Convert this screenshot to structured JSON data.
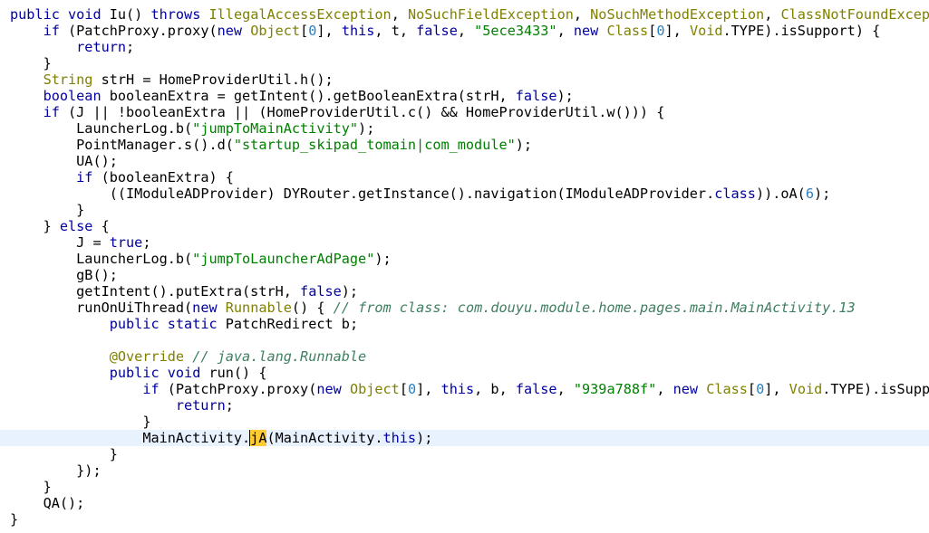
{
  "editor": {
    "lines": [
      {
        "indent": 0,
        "tokens": [
          {
            "t": "kw",
            "v": "public"
          },
          {
            "t": "plain",
            "v": " "
          },
          {
            "t": "kw",
            "v": "void"
          },
          {
            "t": "plain",
            "v": " Iu() "
          },
          {
            "t": "kw",
            "v": "throws"
          },
          {
            "t": "plain",
            "v": " "
          },
          {
            "t": "type",
            "v": "IllegalAccessException"
          },
          {
            "t": "plain",
            "v": ", "
          },
          {
            "t": "type",
            "v": "NoSuchFieldException"
          },
          {
            "t": "plain",
            "v": ", "
          },
          {
            "t": "type",
            "v": "NoSuchMethodException"
          },
          {
            "t": "plain",
            "v": ", "
          },
          {
            "t": "type",
            "v": "ClassNotFoundExcept"
          }
        ]
      },
      {
        "indent": 1,
        "tokens": [
          {
            "t": "kw",
            "v": "if"
          },
          {
            "t": "plain",
            "v": " (PatchProxy.proxy("
          },
          {
            "t": "kw",
            "v": "new"
          },
          {
            "t": "plain",
            "v": " "
          },
          {
            "t": "type",
            "v": "Object"
          },
          {
            "t": "plain",
            "v": "["
          },
          {
            "t": "num",
            "v": "0"
          },
          {
            "t": "plain",
            "v": "], "
          },
          {
            "t": "kw",
            "v": "this"
          },
          {
            "t": "plain",
            "v": ", t, "
          },
          {
            "t": "lit",
            "v": "false"
          },
          {
            "t": "plain",
            "v": ", "
          },
          {
            "t": "str",
            "v": "\"5ece3433\""
          },
          {
            "t": "plain",
            "v": ", "
          },
          {
            "t": "kw",
            "v": "new"
          },
          {
            "t": "plain",
            "v": " "
          },
          {
            "t": "type",
            "v": "Class"
          },
          {
            "t": "plain",
            "v": "["
          },
          {
            "t": "num",
            "v": "0"
          },
          {
            "t": "plain",
            "v": "], "
          },
          {
            "t": "type",
            "v": "Void"
          },
          {
            "t": "plain",
            "v": ".TYPE).isSupport) {"
          }
        ]
      },
      {
        "indent": 2,
        "tokens": [
          {
            "t": "kw",
            "v": "return"
          },
          {
            "t": "plain",
            "v": ";"
          }
        ]
      },
      {
        "indent": 1,
        "tokens": [
          {
            "t": "plain",
            "v": "}"
          }
        ]
      },
      {
        "indent": 1,
        "tokens": [
          {
            "t": "type",
            "v": "String"
          },
          {
            "t": "plain",
            "v": " strH = HomeProviderUtil.h();"
          }
        ]
      },
      {
        "indent": 1,
        "tokens": [
          {
            "t": "kw",
            "v": "boolean"
          },
          {
            "t": "plain",
            "v": " booleanExtra = getIntent().getBooleanExtra(strH, "
          },
          {
            "t": "lit",
            "v": "false"
          },
          {
            "t": "plain",
            "v": ");"
          }
        ]
      },
      {
        "indent": 1,
        "tokens": [
          {
            "t": "kw",
            "v": "if"
          },
          {
            "t": "plain",
            "v": " (J || !booleanExtra || (HomeProviderUtil.c() && HomeProviderUtil.w())) {"
          }
        ]
      },
      {
        "indent": 2,
        "tokens": [
          {
            "t": "plain",
            "v": "LauncherLog.b("
          },
          {
            "t": "str",
            "v": "\"jumpToMainActivity\""
          },
          {
            "t": "plain",
            "v": ");"
          }
        ]
      },
      {
        "indent": 2,
        "tokens": [
          {
            "t": "plain",
            "v": "PointManager.s().d("
          },
          {
            "t": "str",
            "v": "\"startup_skipad_tomain|com_module\""
          },
          {
            "t": "plain",
            "v": ");"
          }
        ]
      },
      {
        "indent": 2,
        "tokens": [
          {
            "t": "plain",
            "v": "UA();"
          }
        ]
      },
      {
        "indent": 2,
        "tokens": [
          {
            "t": "kw",
            "v": "if"
          },
          {
            "t": "plain",
            "v": " (booleanExtra) {"
          }
        ]
      },
      {
        "indent": 3,
        "tokens": [
          {
            "t": "plain",
            "v": "((IModuleADProvider) DYRouter.getInstance().navigation(IModuleADProvider."
          },
          {
            "t": "kw",
            "v": "class"
          },
          {
            "t": "plain",
            "v": ")).oA("
          },
          {
            "t": "num",
            "v": "6"
          },
          {
            "t": "plain",
            "v": ");"
          }
        ]
      },
      {
        "indent": 2,
        "tokens": [
          {
            "t": "plain",
            "v": "}"
          }
        ]
      },
      {
        "indent": 1,
        "tokens": [
          {
            "t": "plain",
            "v": "} "
          },
          {
            "t": "kw",
            "v": "else"
          },
          {
            "t": "plain",
            "v": " {"
          }
        ]
      },
      {
        "indent": 2,
        "tokens": [
          {
            "t": "plain",
            "v": "J = "
          },
          {
            "t": "lit",
            "v": "true"
          },
          {
            "t": "plain",
            "v": ";"
          }
        ]
      },
      {
        "indent": 2,
        "tokens": [
          {
            "t": "plain",
            "v": "LauncherLog.b("
          },
          {
            "t": "str",
            "v": "\"jumpToLauncherAdPage\""
          },
          {
            "t": "plain",
            "v": ");"
          }
        ]
      },
      {
        "indent": 2,
        "tokens": [
          {
            "t": "plain",
            "v": "gB();"
          }
        ]
      },
      {
        "indent": 2,
        "tokens": [
          {
            "t": "plain",
            "v": "getIntent().putExtra(strH, "
          },
          {
            "t": "lit",
            "v": "false"
          },
          {
            "t": "plain",
            "v": ");"
          }
        ]
      },
      {
        "indent": 2,
        "tokens": [
          {
            "t": "plain",
            "v": "runOnUiThread("
          },
          {
            "t": "kw",
            "v": "new"
          },
          {
            "t": "plain",
            "v": " "
          },
          {
            "t": "type",
            "v": "Runnable"
          },
          {
            "t": "plain",
            "v": "() { "
          },
          {
            "t": "cm",
            "v": "// from class: com.douyu.module.home.pages.main.MainActivity.13"
          }
        ]
      },
      {
        "indent": 3,
        "tokens": [
          {
            "t": "kw",
            "v": "public"
          },
          {
            "t": "plain",
            "v": " "
          },
          {
            "t": "kw",
            "v": "static"
          },
          {
            "t": "plain",
            "v": " PatchRedirect b;"
          }
        ]
      },
      {
        "indent": 0,
        "tokens": []
      },
      {
        "indent": 3,
        "tokens": [
          {
            "t": "ann",
            "v": "@Override"
          },
          {
            "t": "plain",
            "v": " "
          },
          {
            "t": "cm",
            "v": "// java.lang.Runnable"
          }
        ]
      },
      {
        "indent": 3,
        "tokens": [
          {
            "t": "kw",
            "v": "public"
          },
          {
            "t": "plain",
            "v": " "
          },
          {
            "t": "kw",
            "v": "void"
          },
          {
            "t": "plain",
            "v": " run() {"
          }
        ]
      },
      {
        "indent": 4,
        "tokens": [
          {
            "t": "kw",
            "v": "if"
          },
          {
            "t": "plain",
            "v": " (PatchProxy.proxy("
          },
          {
            "t": "kw",
            "v": "new"
          },
          {
            "t": "plain",
            "v": " "
          },
          {
            "t": "type",
            "v": "Object"
          },
          {
            "t": "plain",
            "v": "["
          },
          {
            "t": "num",
            "v": "0"
          },
          {
            "t": "plain",
            "v": "], "
          },
          {
            "t": "kw",
            "v": "this"
          },
          {
            "t": "plain",
            "v": ", b, "
          },
          {
            "t": "lit",
            "v": "false"
          },
          {
            "t": "plain",
            "v": ", "
          },
          {
            "t": "str",
            "v": "\"939a788f\""
          },
          {
            "t": "plain",
            "v": ", "
          },
          {
            "t": "kw",
            "v": "new"
          },
          {
            "t": "plain",
            "v": " "
          },
          {
            "t": "type",
            "v": "Class"
          },
          {
            "t": "plain",
            "v": "["
          },
          {
            "t": "num",
            "v": "0"
          },
          {
            "t": "plain",
            "v": "], "
          },
          {
            "t": "type",
            "v": "Void"
          },
          {
            "t": "plain",
            "v": ".TYPE).isSuppo"
          }
        ]
      },
      {
        "indent": 5,
        "tokens": [
          {
            "t": "kw",
            "v": "return"
          },
          {
            "t": "plain",
            "v": ";"
          }
        ]
      },
      {
        "indent": 4,
        "tokens": [
          {
            "t": "plain",
            "v": "}"
          }
        ]
      },
      {
        "indent": 4,
        "current": true,
        "tokens": [
          {
            "t": "plain",
            "v": "MainActivity."
          },
          {
            "t": "cur",
            "v": "jA"
          },
          {
            "t": "plain",
            "v": "(MainActivity."
          },
          {
            "t": "kw",
            "v": "this"
          },
          {
            "t": "plain",
            "v": ");"
          }
        ]
      },
      {
        "indent": 3,
        "tokens": [
          {
            "t": "plain",
            "v": "}"
          }
        ]
      },
      {
        "indent": 2,
        "tokens": [
          {
            "t": "plain",
            "v": "});"
          }
        ]
      },
      {
        "indent": 1,
        "tokens": [
          {
            "t": "plain",
            "v": "}"
          }
        ]
      },
      {
        "indent": 1,
        "tokens": [
          {
            "t": "plain",
            "v": "QA();"
          }
        ]
      },
      {
        "indent": 0,
        "tokens": [
          {
            "t": "plain",
            "v": "}"
          }
        ]
      }
    ],
    "colors": {
      "keyword": "#0000a0",
      "type": "#808000",
      "string": "#008000",
      "number": "#2a7fbf",
      "comment": "#3f7f5f",
      "current_line": "#e8f2fe",
      "highlight": "#ffcc33"
    }
  }
}
